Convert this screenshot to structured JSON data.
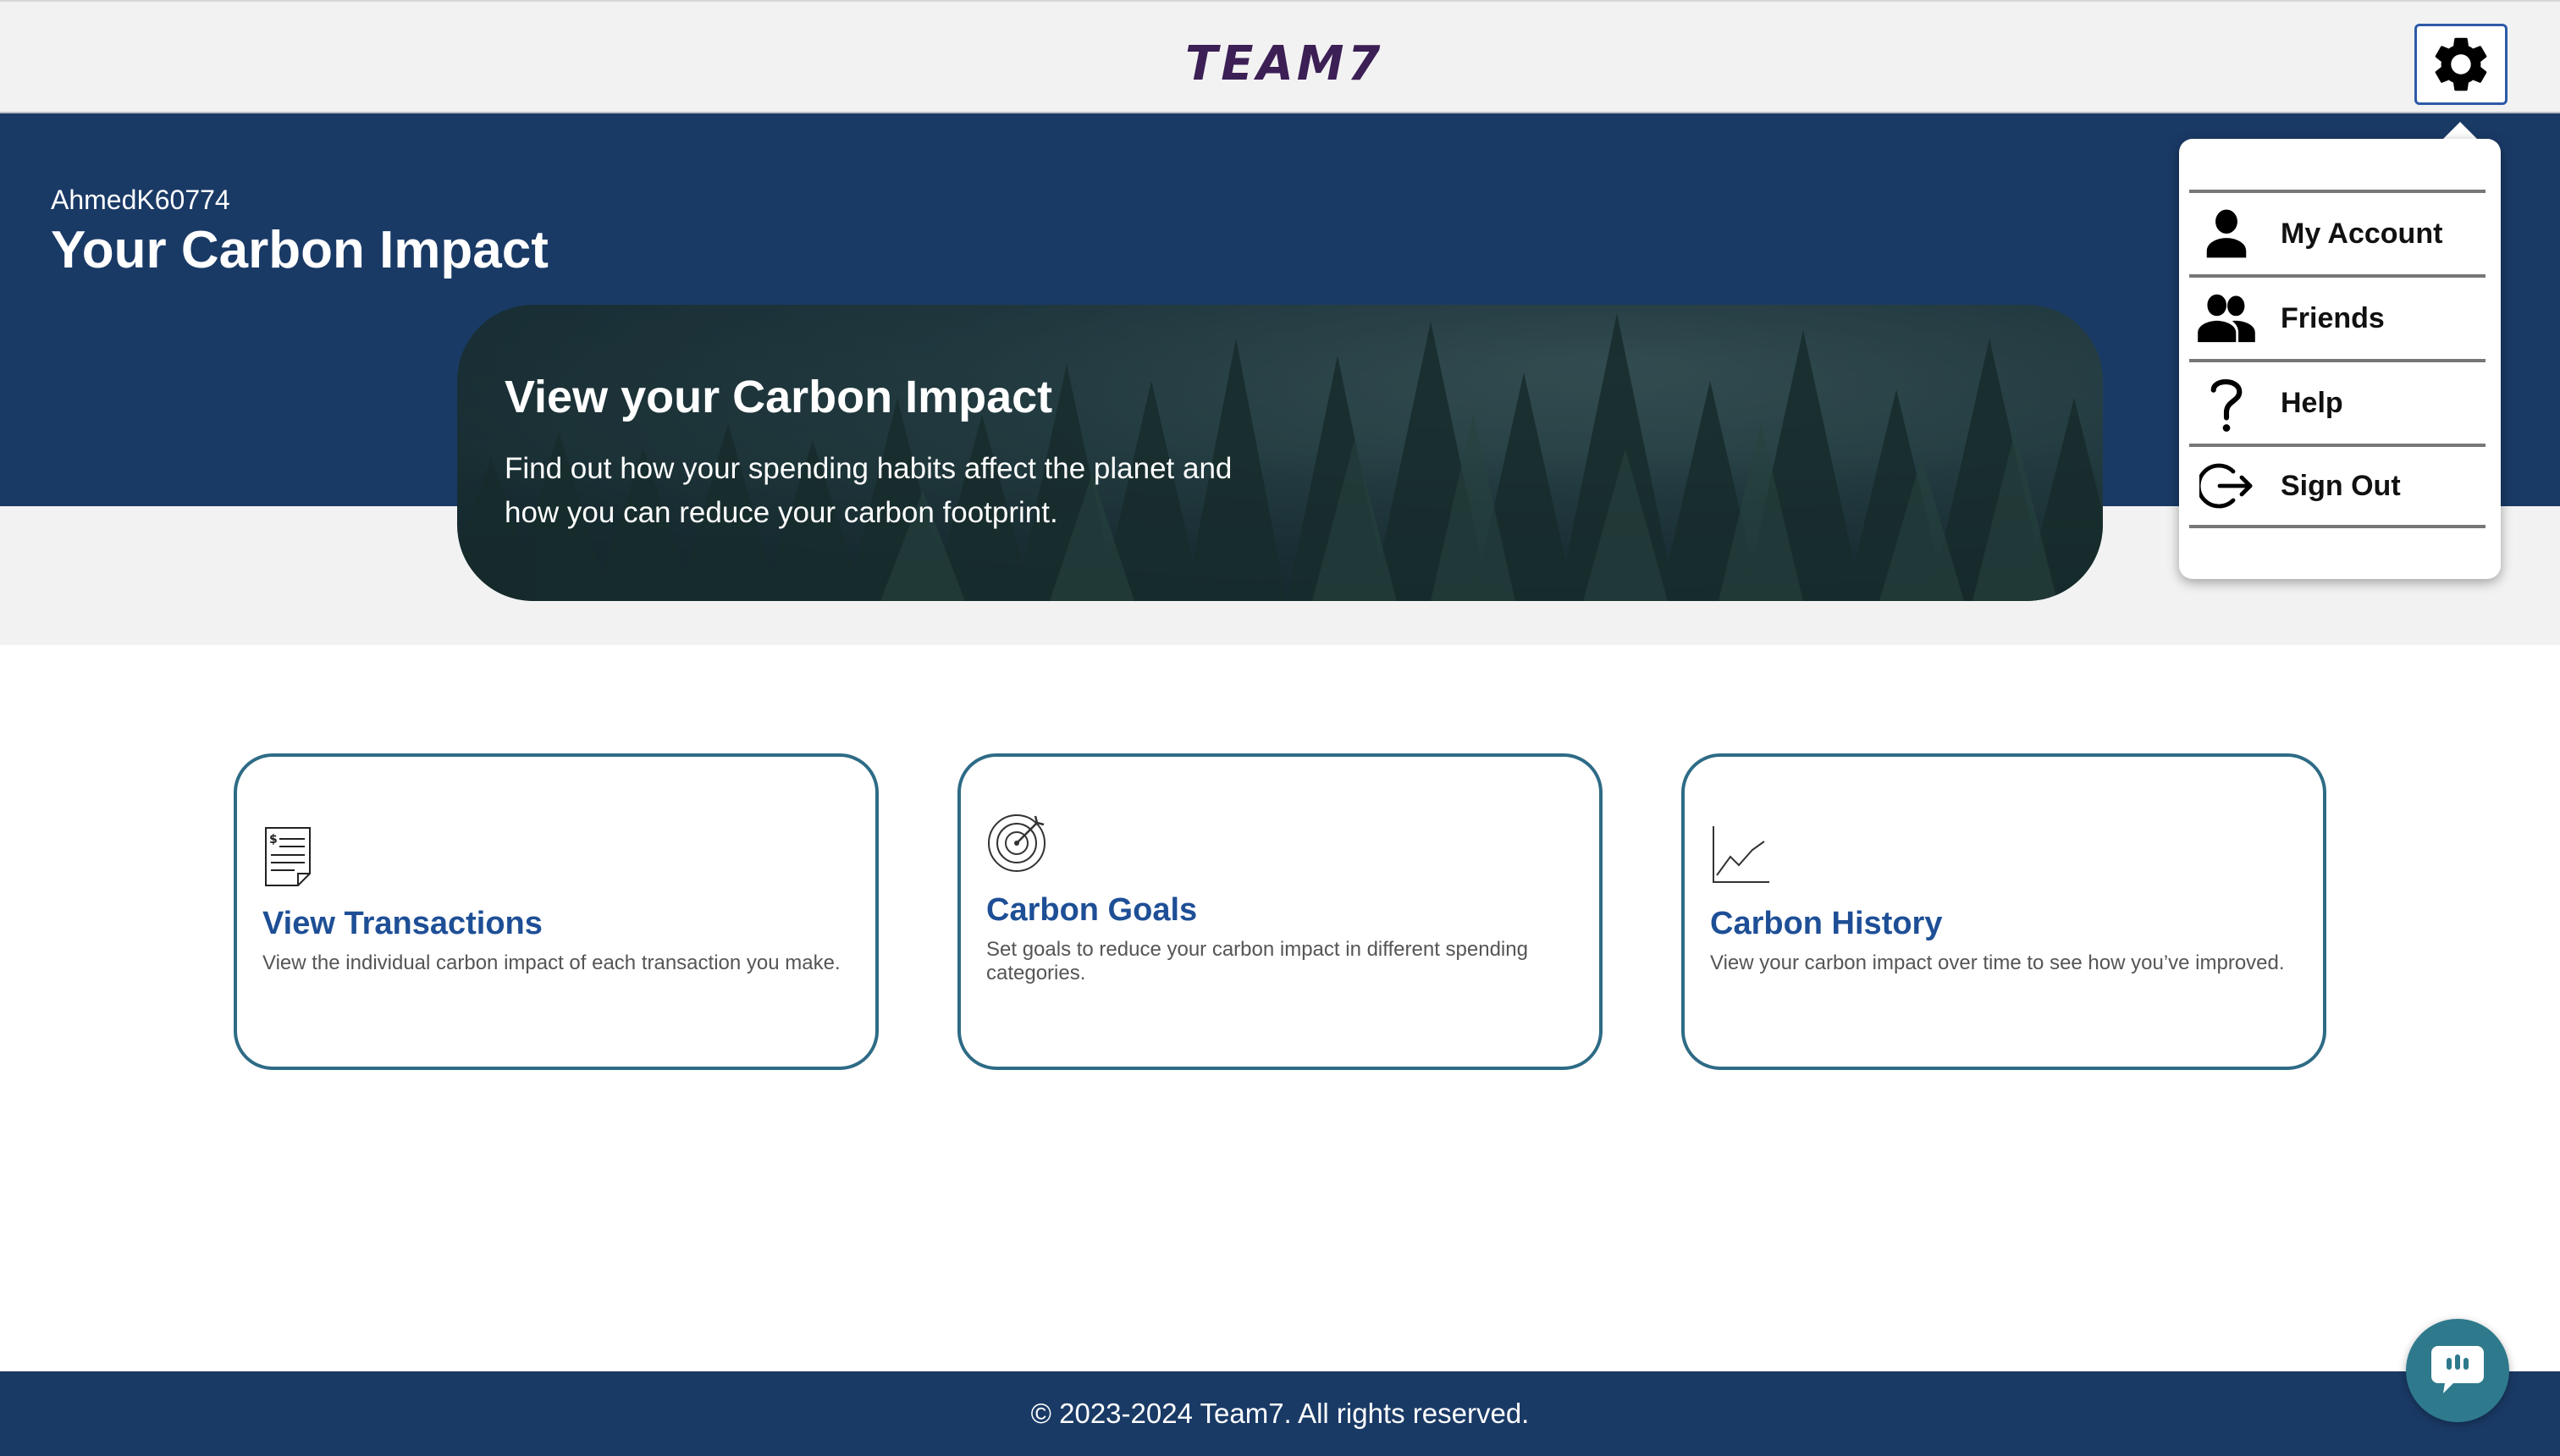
{
  "header": {
    "logo_text": "TEAM7",
    "settings_icon": "gear-icon"
  },
  "hero": {
    "username": "AhmedK60774",
    "title": "Your Carbon Impact"
  },
  "banner": {
    "title": "View your Carbon Impact",
    "text": "Find out how your spending habits affect the planet and how you can reduce your carbon footprint."
  },
  "cards": [
    {
      "icon": "receipt-icon",
      "title": "View Transactions",
      "description": "View the individual carbon impact of each transaction you make."
    },
    {
      "icon": "target-icon",
      "title": "Carbon Goals",
      "description": "Set goals to reduce your carbon impact in different spending categories."
    },
    {
      "icon": "line-chart-icon",
      "title": "Carbon History",
      "description": "View your carbon impact over time to see how you’ve improved."
    }
  ],
  "menu": {
    "items": [
      {
        "icon": "person-icon",
        "label": "My Account"
      },
      {
        "icon": "friends-icon",
        "label": "Friends"
      },
      {
        "icon": "question-icon",
        "label": "Help"
      },
      {
        "icon": "sign-out-icon",
        "label": "Sign Out"
      }
    ]
  },
  "footer": {
    "text": "© 2023-2024 Team7. All rights reserved."
  },
  "chat": {
    "icon": "chat-icon"
  },
  "colors": {
    "navy": "#1a3a66",
    "card_border": "#2e6b86",
    "card_title": "#1e4f96",
    "chat_button": "#2e7a8c"
  }
}
